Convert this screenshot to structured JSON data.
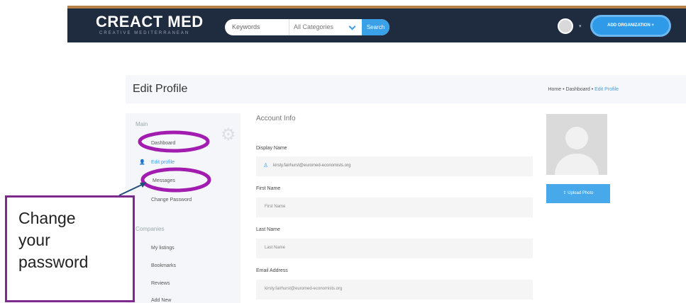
{
  "header": {
    "logo": "CREACT MED",
    "logo_sub": "CREATIVE MEDITERRANEAN",
    "search": {
      "keywords_placeholder": "Keywords",
      "category": "All Categories",
      "button": "Search"
    },
    "add_org": "ADD ORGANIZATION +"
  },
  "page": {
    "title": "Edit Profile",
    "breadcrumb": [
      "Home",
      "Dashboard",
      "Edit Profile"
    ]
  },
  "sidebar": {
    "main_heading": "Main",
    "main_items": [
      "Dashboard",
      "Edit profile",
      "Messages",
      "Change Password"
    ],
    "companies_heading": "Companies",
    "company_items": [
      "My listings",
      "Bookmarks",
      "Reviews",
      "Add New"
    ]
  },
  "form": {
    "heading": "Account Info",
    "display_name": {
      "label": "Display Name",
      "value": "kirsty.fairhurst@euromed-economists.org"
    },
    "first_name": {
      "label": "First Name",
      "placeholder": "First Name"
    },
    "last_name": {
      "label": "Last Name",
      "placeholder": "Last Name"
    },
    "email": {
      "label": "Email Address",
      "value": "kirsty.fairhurst@euromed-economists.org"
    },
    "upload_button": "Upload Photo"
  },
  "callout": {
    "text": "Change\nyour\npassword"
  },
  "colors": {
    "accent": "#3aa0e8",
    "highlight": "#a21caf",
    "callout_border": "#7c2a8c"
  }
}
